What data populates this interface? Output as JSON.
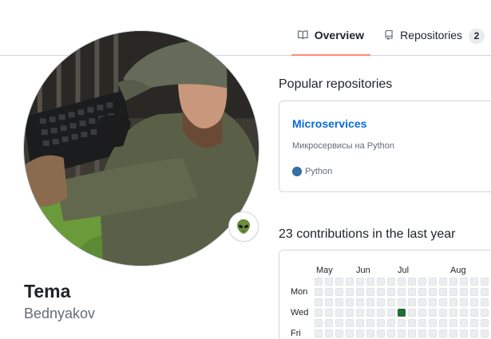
{
  "tabs": [
    {
      "label": "Overview",
      "icon": "book-icon",
      "active": true
    },
    {
      "label": "Repositories",
      "icon": "repo-icon",
      "count": "2"
    }
  ],
  "profile": {
    "name": "Tema",
    "login": "Bednyakov",
    "status_emoji": "alien-emoji-icon"
  },
  "popular": {
    "title": "Popular repositories",
    "repos": [
      {
        "name": "Microservices",
        "description": "Микросервисы на Python",
        "language": "Python",
        "language_color": "#3572A5"
      }
    ]
  },
  "contributions": {
    "title": "23 contributions in the last year",
    "months": [
      "May",
      "Jun",
      "Jul",
      "Aug"
    ],
    "days": [
      "Mon",
      "Wed",
      "Fri"
    ],
    "colors": {
      "empty": "#ebedf0",
      "level2": "#216e39"
    },
    "highlighted_cell": {
      "week": 8,
      "weekday": 3,
      "level": 2
    }
  }
}
